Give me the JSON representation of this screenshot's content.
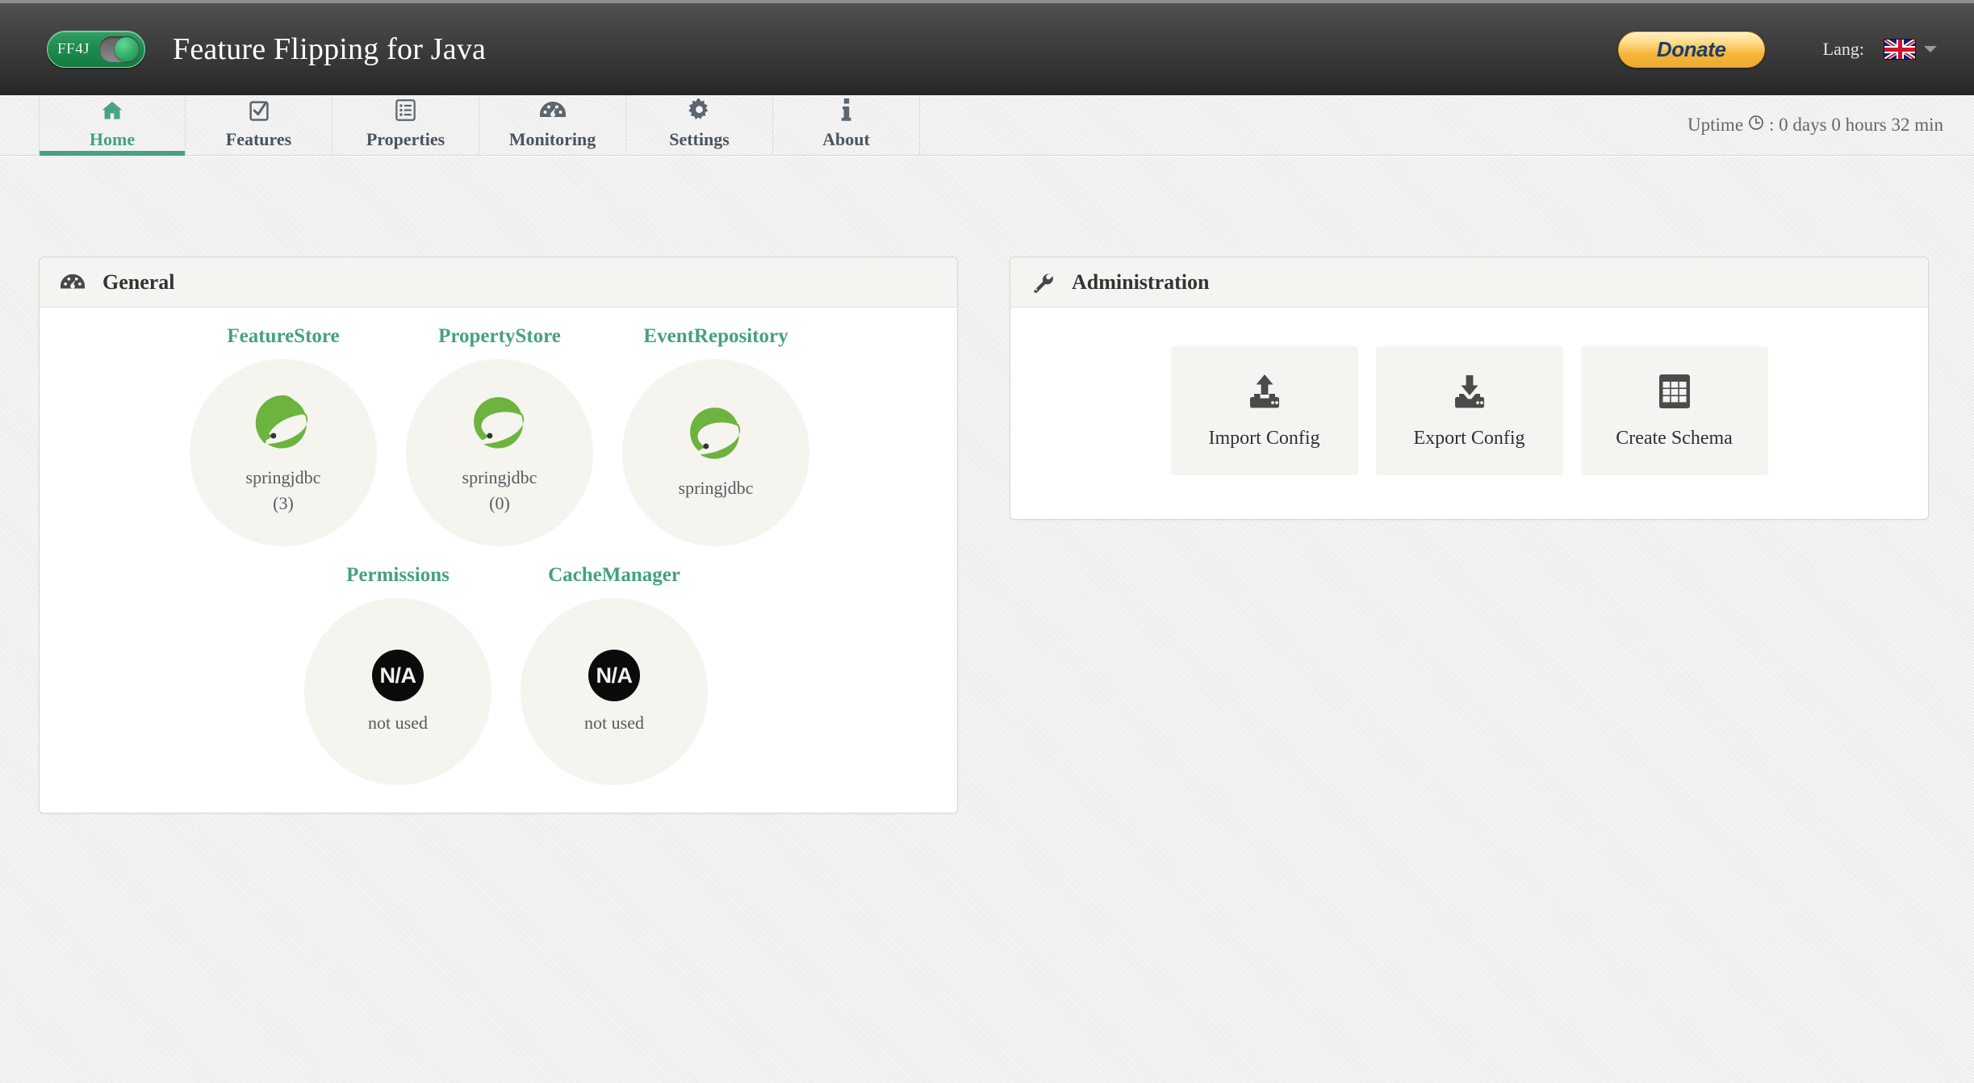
{
  "header": {
    "logo_text": "FF4J",
    "title": "Feature Flipping for Java",
    "donate_label": "Donate",
    "lang_label": "Lang:",
    "flag_icon": "uk-flag-icon"
  },
  "nav": {
    "tabs": [
      {
        "label": "Home",
        "icon": "home-icon",
        "active": true
      },
      {
        "label": "Features",
        "icon": "checkbox-icon",
        "active": false
      },
      {
        "label": "Properties",
        "icon": "list-icon",
        "active": false
      },
      {
        "label": "Monitoring",
        "icon": "dashboard-icon",
        "active": false
      },
      {
        "label": "Settings",
        "icon": "gear-icon",
        "active": false
      },
      {
        "label": "About",
        "icon": "info-icon",
        "active": false
      }
    ],
    "uptime_prefix": "Uptime",
    "uptime_icon": "clock-icon",
    "uptime_value": ": 0 days 0 hours 32 min"
  },
  "general_panel": {
    "title": "General",
    "icon": "dashboard-icon",
    "stores_row1": [
      {
        "title": "FeatureStore",
        "logo": "spring-leaf-icon",
        "name": "springjdbc",
        "count": "(3)"
      },
      {
        "title": "PropertyStore",
        "logo": "spring-leaf-icon",
        "name": "springjdbc",
        "count": "(0)"
      },
      {
        "title": "EventRepository",
        "logo": "spring-leaf-icon",
        "name": "springjdbc",
        "count": ""
      }
    ],
    "stores_row2": [
      {
        "title": "Permissions",
        "logo": "na-badge",
        "name": "not used",
        "count": ""
      },
      {
        "title": "CacheManager",
        "logo": "na-badge",
        "name": "not used",
        "count": ""
      }
    ],
    "na_text": "N/A"
  },
  "admin_panel": {
    "title": "Administration",
    "icon": "wrench-icon",
    "buttons": [
      {
        "label": "Import Config",
        "icon": "upload-icon"
      },
      {
        "label": "Export Config",
        "icon": "download-icon"
      },
      {
        "label": "Create Schema",
        "icon": "table-grid-icon"
      }
    ]
  },
  "colors": {
    "accent_green": "#44a183",
    "spring_green": "#6db33f",
    "header_dark": "#3a3a3a",
    "donate_orange": "#f6b63c"
  }
}
